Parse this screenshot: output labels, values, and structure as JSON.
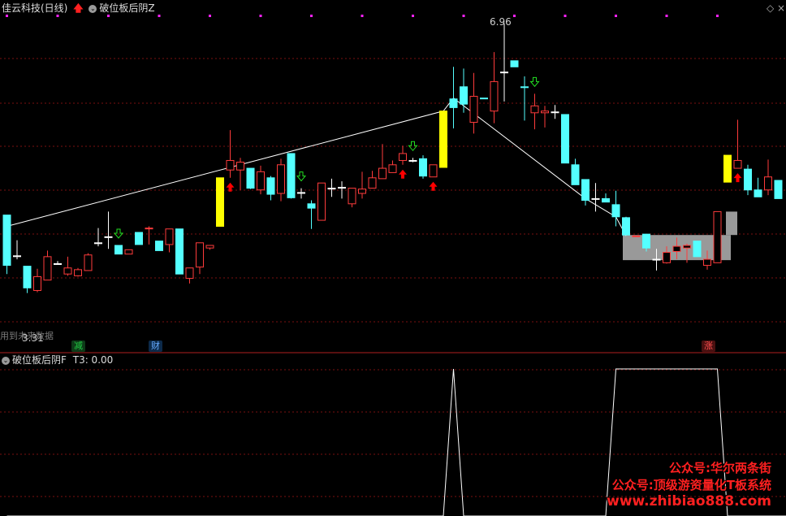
{
  "main_panel": {
    "stock_title": "佳云科技(日线)",
    "indicator_name": "破位板后阴Z",
    "max_label": "6.96",
    "min_label": "3.31",
    "note_text": "用到未来数据",
    "badges": [
      {
        "text": "减",
        "color": "#22cc44"
      },
      {
        "text": "财",
        "color": "#66aaff"
      },
      {
        "text": "涨",
        "color": "#ff4040"
      }
    ]
  },
  "sub_panel": {
    "indicator_name": "破位板后阴F",
    "value_label": "T3: 0.00"
  },
  "watermark": {
    "line1": "公众号:华尔两条街",
    "line2": "公众号:顶级游资量化T板系统",
    "line3": "www.zhibiao888.com"
  },
  "colors": {
    "up_candle": "#ff3b3b",
    "down_candle": "#54ffff",
    "limit_up_bar": "#ffff00",
    "trend_line": "#ffffff",
    "signal_up_arrow": "#ff0000",
    "signal_down_arrow": "#22dd22",
    "dot_marker": "#ff22ff",
    "zone_fill": "#999999",
    "grid": "#7a1010",
    "watermark": "#ff2020"
  },
  "chart_data": {
    "type": "candlestick",
    "ohlc": [
      {
        "o": 4.75,
        "h": 4.75,
        "l": 4.07,
        "c": 4.17,
        "t": "d"
      },
      {
        "o": 4.28,
        "h": 4.46,
        "l": 4.24,
        "c": 4.28,
        "t": "c"
      },
      {
        "o": 4.16,
        "h": 4.16,
        "l": 3.85,
        "c": 3.91,
        "t": "d"
      },
      {
        "o": 3.88,
        "h": 4.13,
        "l": 3.86,
        "c": 4.04,
        "t": "u"
      },
      {
        "o": 4.0,
        "h": 4.34,
        "l": 4.0,
        "c": 4.27,
        "t": "u"
      },
      {
        "o": 4.18,
        "h": 4.22,
        "l": 4.18,
        "c": 4.19,
        "t": "c"
      },
      {
        "o": 4.07,
        "h": 4.27,
        "l": 4.05,
        "c": 4.14,
        "t": "u"
      },
      {
        "o": 4.05,
        "h": 4.14,
        "l": 4.04,
        "c": 4.12,
        "t": "u"
      },
      {
        "o": 4.11,
        "h": 4.31,
        "l": 4.11,
        "c": 4.29,
        "t": "u"
      },
      {
        "o": 4.43,
        "h": 4.6,
        "l": 4.39,
        "c": 4.43,
        "t": "c"
      },
      {
        "o": 4.5,
        "h": 4.79,
        "l": 4.36,
        "c": 4.5,
        "t": "c"
      },
      {
        "o": 4.4,
        "h": 4.4,
        "l": 4.3,
        "c": 4.3,
        "t": "d"
      },
      {
        "o": 4.3,
        "h": 4.35,
        "l": 4.3,
        "c": 4.35,
        "t": "u"
      },
      {
        "o": 4.55,
        "h": 4.55,
        "l": 4.41,
        "c": 4.41,
        "t": "d"
      },
      {
        "o": 4.6,
        "h": 4.62,
        "l": 4.41,
        "c": 4.6,
        "t": "u"
      },
      {
        "o": 4.45,
        "h": 4.45,
        "l": 4.34,
        "c": 4.34,
        "t": "d"
      },
      {
        "o": 4.41,
        "h": 4.59,
        "l": 4.32,
        "c": 4.59,
        "t": "u"
      },
      {
        "o": 4.59,
        "h": 4.59,
        "l": 4.07,
        "c": 4.07,
        "t": "d"
      },
      {
        "o": 4.02,
        "h": 4.14,
        "l": 3.96,
        "c": 4.14,
        "t": "u"
      },
      {
        "o": 4.15,
        "h": 4.43,
        "l": 4.07,
        "c": 4.43,
        "t": "u"
      },
      {
        "o": 4.37,
        "h": 4.4,
        "l": 4.35,
        "c": 4.4,
        "t": "u"
      },
      {
        "o": 4.62,
        "h": 5.18,
        "l": 4.62,
        "c": 5.18,
        "t": "y"
      },
      {
        "o": 5.27,
        "h": 5.73,
        "l": 5.18,
        "c": 5.38,
        "t": "u"
      },
      {
        "o": 5.36,
        "h": 5.41,
        "l": 5.04,
        "c": 5.27,
        "t": "u"
      },
      {
        "o": 5.29,
        "h": 5.29,
        "l": 5.05,
        "c": 5.06,
        "t": "d"
      },
      {
        "o": 5.04,
        "h": 5.32,
        "l": 4.99,
        "c": 5.25,
        "t": "u"
      },
      {
        "o": 5.18,
        "h": 5.2,
        "l": 4.92,
        "c": 4.99,
        "t": "d"
      },
      {
        "o": 5.0,
        "h": 5.4,
        "l": 4.91,
        "c": 5.33,
        "t": "u"
      },
      {
        "o": 5.46,
        "h": 5.46,
        "l": 4.94,
        "c": 4.95,
        "t": "d"
      },
      {
        "o": 5.01,
        "h": 5.06,
        "l": 4.94,
        "c": 5.01,
        "t": "c"
      },
      {
        "o": 4.88,
        "h": 4.92,
        "l": 4.59,
        "c": 4.83,
        "t": "d"
      },
      {
        "o": 4.69,
        "h": 5.12,
        "l": 4.69,
        "c": 5.12,
        "t": "u"
      },
      {
        "o": 5.06,
        "h": 5.17,
        "l": 4.96,
        "c": 5.06,
        "t": "c"
      },
      {
        "o": 5.07,
        "h": 5.14,
        "l": 4.94,
        "c": 5.07,
        "t": "c"
      },
      {
        "o": 4.88,
        "h": 5.06,
        "l": 4.84,
        "c": 5.06,
        "t": "u"
      },
      {
        "o": 5.0,
        "h": 5.25,
        "l": 4.94,
        "c": 5.05,
        "t": "u"
      },
      {
        "o": 5.06,
        "h": 5.26,
        "l": 5.06,
        "c": 5.18,
        "t": "u"
      },
      {
        "o": 5.17,
        "h": 5.57,
        "l": 5.17,
        "c": 5.29,
        "t": "u"
      },
      {
        "o": 5.24,
        "h": 5.38,
        "l": 5.24,
        "c": 5.33,
        "t": "u"
      },
      {
        "o": 5.38,
        "h": 5.55,
        "l": 5.33,
        "c": 5.46,
        "t": "u"
      },
      {
        "o": 5.38,
        "h": 5.41,
        "l": 5.36,
        "c": 5.38,
        "t": "c"
      },
      {
        "o": 5.4,
        "h": 5.44,
        "l": 5.17,
        "c": 5.2,
        "t": "d"
      },
      {
        "o": 5.19,
        "h": 5.33,
        "l": 5.19,
        "c": 5.33,
        "t": "u"
      },
      {
        "o": 5.3,
        "h": 5.95,
        "l": 5.3,
        "c": 5.95,
        "t": "y"
      },
      {
        "o": 5.99,
        "h": 6.46,
        "l": 5.75,
        "c": 6.09,
        "t": "d"
      },
      {
        "o": 6.23,
        "h": 6.44,
        "l": 5.93,
        "c": 6.03,
        "t": "d"
      },
      {
        "o": 5.82,
        "h": 6.39,
        "l": 5.69,
        "c": 6.12,
        "t": "u"
      },
      {
        "o": 6.1,
        "h": 6.1,
        "l": 6.1,
        "c": 6.1,
        "t": "d"
      },
      {
        "o": 5.95,
        "h": 6.63,
        "l": 5.81,
        "c": 6.29,
        "t": "u"
      },
      {
        "o": 6.4,
        "h": 6.96,
        "l": 6.06,
        "c": 6.4,
        "t": "c"
      },
      {
        "o": 6.46,
        "h": 6.53,
        "l": 6.46,
        "c": 6.53,
        "t": "d"
      },
      {
        "o": 6.23,
        "h": 6.35,
        "l": 5.84,
        "c": 6.23,
        "t": "d"
      },
      {
        "o": 6.01,
        "h": 6.15,
        "l": 5.74,
        "c": 5.93,
        "t": "u"
      },
      {
        "o": 5.95,
        "h": 6.01,
        "l": 5.76,
        "c": 5.93,
        "t": "u"
      },
      {
        "o": 5.94,
        "h": 6.02,
        "l": 5.86,
        "c": 5.94,
        "t": "c"
      },
      {
        "o": 5.91,
        "h": 5.91,
        "l": 5.35,
        "c": 5.35,
        "t": "d"
      },
      {
        "o": 5.33,
        "h": 5.4,
        "l": 5.1,
        "c": 5.1,
        "t": "d"
      },
      {
        "o": 5.16,
        "h": 5.16,
        "l": 4.86,
        "c": 4.92,
        "t": "d"
      },
      {
        "o": 4.94,
        "h": 5.12,
        "l": 4.79,
        "c": 4.94,
        "t": "c"
      },
      {
        "o": 4.94,
        "h": 5.0,
        "l": 4.9,
        "c": 4.9,
        "t": "d"
      },
      {
        "o": 4.87,
        "h": 5.03,
        "l": 4.62,
        "c": 4.73,
        "t": "d"
      },
      {
        "o": 4.72,
        "h": 4.73,
        "l": 4.52,
        "c": 4.52,
        "t": "d"
      },
      {
        "o": 4.51,
        "h": 4.51,
        "l": 4.51,
        "c": 4.51,
        "t": "u"
      },
      {
        "o": 4.53,
        "h": 4.53,
        "l": 4.33,
        "c": 4.37,
        "t": "d"
      },
      {
        "o": 4.24,
        "h": 4.36,
        "l": 4.11,
        "c": 4.24,
        "t": "c"
      },
      {
        "o": 4.2,
        "h": 4.39,
        "l": 4.19,
        "c": 4.32,
        "t": "u"
      },
      {
        "o": 4.33,
        "h": 4.49,
        "l": 4.24,
        "c": 4.39,
        "t": "u"
      },
      {
        "o": 4.4,
        "h": 4.42,
        "l": 4.2,
        "c": 4.37,
        "t": "u"
      },
      {
        "o": 4.45,
        "h": 4.45,
        "l": 4.27,
        "c": 4.27,
        "t": "d"
      },
      {
        "o": 4.17,
        "h": 4.34,
        "l": 4.12,
        "c": 4.24,
        "t": "u"
      },
      {
        "o": 4.2,
        "h": 4.79,
        "l": 4.2,
        "c": 4.79,
        "t": "u"
      },
      {
        "o": 5.44,
        "h": 5.44,
        "l": 5.13,
        "c": 5.13,
        "t": "y"
      },
      {
        "o": 5.29,
        "h": 5.85,
        "l": 5.29,
        "c": 5.38,
        "t": "u"
      },
      {
        "o": 5.28,
        "h": 5.33,
        "l": 4.98,
        "c": 5.04,
        "t": "d"
      },
      {
        "o": 5.04,
        "h": 5.18,
        "l": 4.98,
        "c": 4.96,
        "t": "d"
      },
      {
        "o": 5.04,
        "h": 5.39,
        "l": 4.98,
        "c": 5.19,
        "t": "u"
      },
      {
        "o": 5.15,
        "h": 5.15,
        "l": 4.94,
        "c": 4.94,
        "t": "d"
      }
    ],
    "trend_line_1": [
      [
        0,
        4.62
      ],
      [
        43,
        5.95
      ],
      [
        44,
        6.1
      ],
      [
        57,
        4.94
      ],
      [
        60,
        4.73
      ],
      [
        61,
        4.51
      ]
    ],
    "zone": {
      "from": 61,
      "to": 71,
      "low": 4.23,
      "high": 4.52,
      "right_high": 4.79
    },
    "sub_indicator": [
      {
        "i": 0,
        "v": 0
      },
      {
        "i": 43,
        "v": 0
      },
      {
        "i": 44,
        "v": 1
      },
      {
        "i": 45,
        "v": 0
      },
      {
        "i": 59,
        "v": 0
      },
      {
        "i": 60,
        "v": 1
      },
      {
        "i": 70,
        "v": 1
      },
      {
        "i": 71,
        "v": 0
      },
      {
        "i": 77,
        "v": 0
      }
    ],
    "signals_up": [
      22,
      39,
      42,
      72
    ],
    "signals_down": [
      11,
      29,
      40,
      52
    ],
    "price_range": [
      3.2,
      7.1
    ],
    "sub_range": [
      0,
      1
    ]
  }
}
